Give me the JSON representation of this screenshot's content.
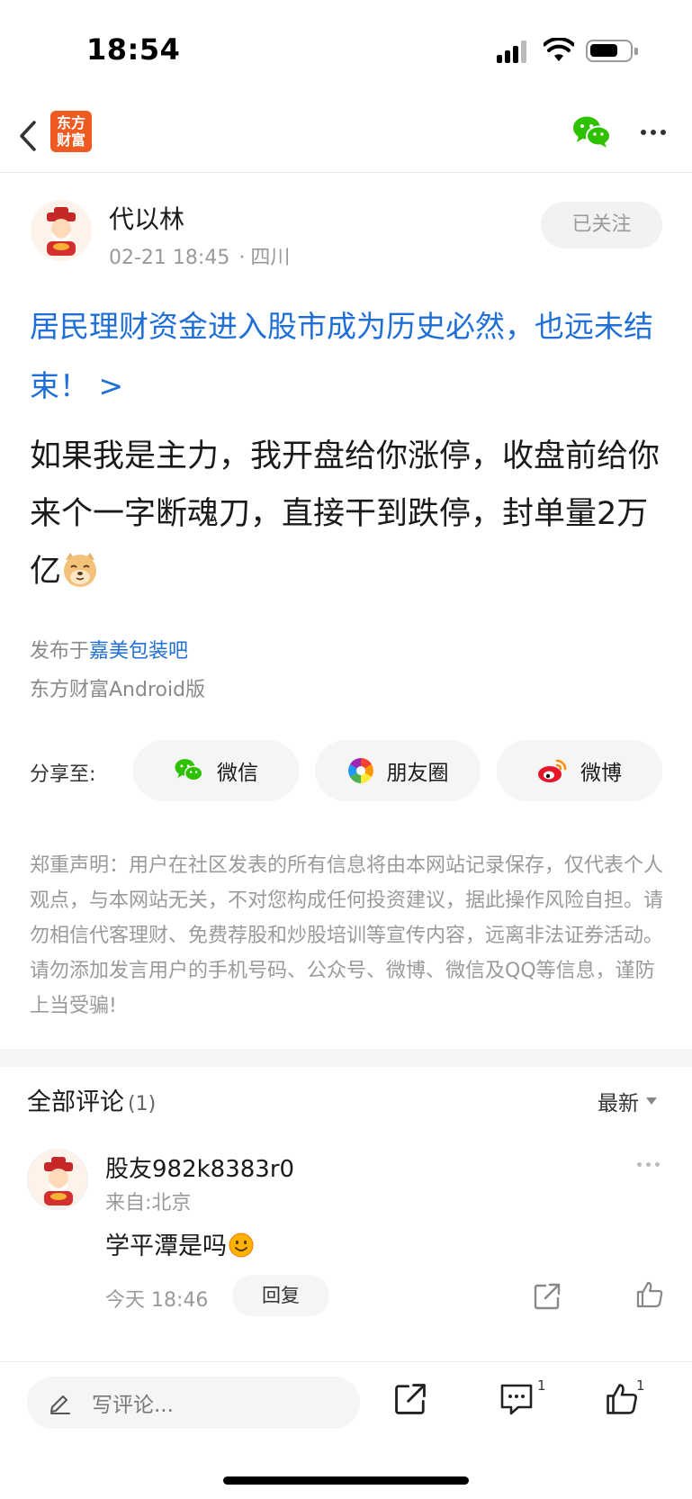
{
  "status_bar": {
    "time": "18:54"
  },
  "nav": {
    "logo_line1": "东方",
    "logo_line2": "财富",
    "brand_color": "#ef5a23"
  },
  "author": {
    "name": "代以林",
    "time": "02-21 18:45",
    "location": "四川",
    "follow_label": "已关注"
  },
  "post": {
    "title": "居民理财资金进入股市成为历史必然，也远未结束！ >",
    "content": "如果我是主力，我开盘给你涨停，收盘前给你来个一字断魂刀，直接干到跌停，封单量2万亿",
    "published_prefix": "发布于",
    "forum_link": "嘉美包装吧",
    "client": "东方财富Android版",
    "link_color": "#1f6fd6"
  },
  "share": {
    "label": "分享至:",
    "buttons": [
      {
        "label": "微信",
        "icon": "wechat-icon"
      },
      {
        "label": "朋友圈",
        "icon": "moments-icon"
      },
      {
        "label": "微博",
        "icon": "weibo-icon"
      }
    ]
  },
  "disclaimer": "郑重声明：用户在社区发表的所有信息将由本网站记录保存，仅代表个人观点，与本网站无关，不对您构成任何投资建议，据此操作风险自担。请勿相信代客理财、免费荐股和炒股培训等宣传内容，远离非法证券活动。请勿添加发言用户的手机号码、公众号、微博、微信及QQ等信息，谨防上当受骗!",
  "comments": {
    "header": "全部评论",
    "count": "(1)",
    "sort": "最新",
    "items": [
      {
        "user": "股友982k8383r0",
        "from": "来自:北京",
        "text": "学平潭是吗",
        "time": "今天 18:46",
        "reply_label": "回复"
      }
    ]
  },
  "bottom_bar": {
    "input_placeholder": "写评论...",
    "comment_count": "1",
    "like_count": "1"
  }
}
